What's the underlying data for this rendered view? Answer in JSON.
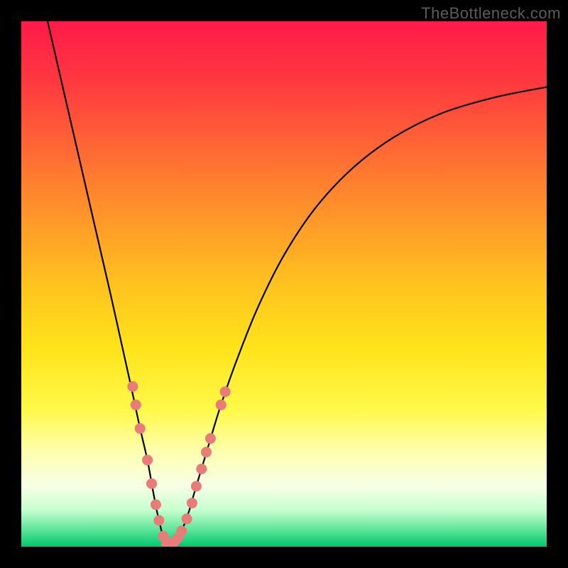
{
  "watermark": "TheBottleneck.com",
  "chart_data": {
    "type": "line",
    "title": "",
    "xlabel": "",
    "ylabel": "",
    "xlim": [
      0,
      100
    ],
    "ylim": [
      0,
      100
    ],
    "grid": false,
    "legend": false,
    "background_gradient": {
      "stops": [
        {
          "pos": 0.0,
          "color": "#ff1a49"
        },
        {
          "pos": 0.12,
          "color": "#ff3a3f"
        },
        {
          "pos": 0.3,
          "color": "#ff7d2f"
        },
        {
          "pos": 0.5,
          "color": "#ffc21f"
        },
        {
          "pos": 0.62,
          "color": "#ffe31a"
        },
        {
          "pos": 0.74,
          "color": "#fff94a"
        },
        {
          "pos": 0.82,
          "color": "#feffb0"
        },
        {
          "pos": 0.885,
          "color": "#f7ffe5"
        },
        {
          "pos": 0.93,
          "color": "#c6ffcf"
        },
        {
          "pos": 0.965,
          "color": "#65e79d"
        },
        {
          "pos": 1.0,
          "color": "#00c76c"
        }
      ]
    },
    "series": [
      {
        "name": "bottleneck-curve",
        "stroke": "#000000",
        "x": [
          5,
          8,
          11,
          14,
          17,
          19,
          21,
          22.5,
          24,
          25,
          25.8,
          26.5,
          27,
          27.5,
          28,
          29,
          30,
          31,
          32,
          33,
          34.5,
          36,
          38,
          41,
          45,
          50,
          56,
          63,
          71,
          80,
          90,
          100
        ],
        "y": [
          100,
          87,
          74,
          61,
          48,
          39,
          30,
          23,
          16.5,
          11,
          6.8,
          3.8,
          1.8,
          0.6,
          0.4,
          0.8,
          2.0,
          4.2,
          7.0,
          10.5,
          15.5,
          20.5,
          27.0,
          35.5,
          45.5,
          55.5,
          64.5,
          72.0,
          78.0,
          82.5,
          85.5,
          87.5
        ]
      }
    ],
    "scatter": [
      {
        "name": "datapoints",
        "color": "#e97c78",
        "r": 7.5,
        "points": [
          {
            "x": 21.2,
            "y": 30.5
          },
          {
            "x": 21.8,
            "y": 27.0
          },
          {
            "x": 22.6,
            "y": 22.5
          },
          {
            "x": 24.0,
            "y": 16.5
          },
          {
            "x": 24.8,
            "y": 12.0
          },
          {
            "x": 25.6,
            "y": 8.0
          },
          {
            "x": 26.2,
            "y": 5.0
          },
          {
            "x": 27.0,
            "y": 2.0
          },
          {
            "x": 27.6,
            "y": 0.6
          },
          {
            "x": 28.3,
            "y": 0.6
          },
          {
            "x": 29.0,
            "y": 0.8
          },
          {
            "x": 29.7,
            "y": 1.6
          },
          {
            "x": 30.5,
            "y": 3.0
          },
          {
            "x": 31.5,
            "y": 5.3
          },
          {
            "x": 32.5,
            "y": 8.3
          },
          {
            "x": 33.3,
            "y": 11.5
          },
          {
            "x": 34.3,
            "y": 14.8
          },
          {
            "x": 35.2,
            "y": 18.0
          },
          {
            "x": 36.0,
            "y": 20.6
          },
          {
            "x": 38.0,
            "y": 27.0
          },
          {
            "x": 38.8,
            "y": 29.5
          }
        ]
      }
    ]
  }
}
